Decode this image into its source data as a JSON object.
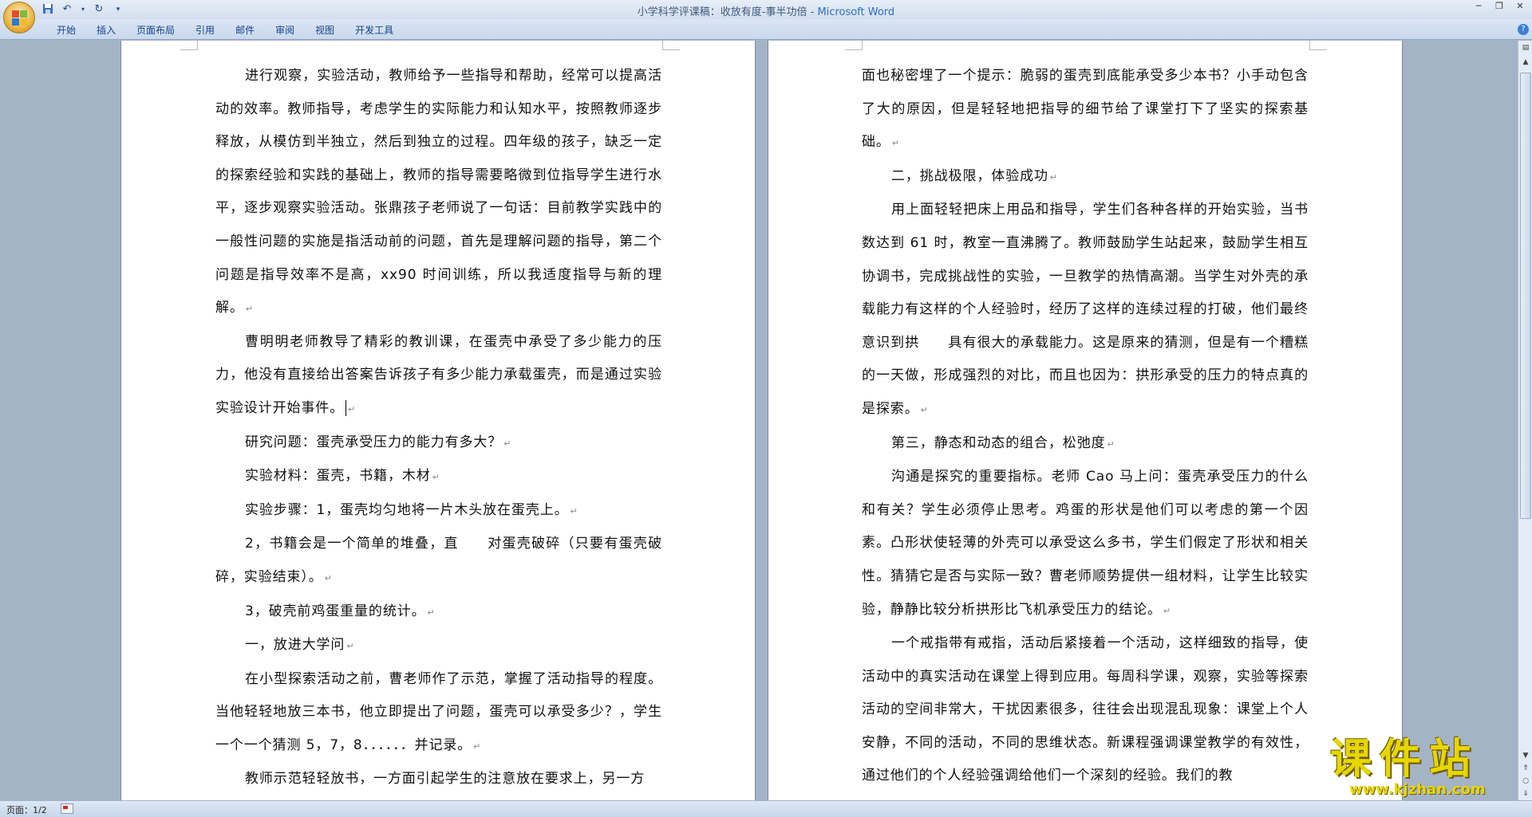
{
  "window": {
    "title_doc": "小学科学评课稿：收放有度-事半功倍",
    "title_sep": " - ",
    "title_app": "Microsoft Word"
  },
  "quick_access": [
    "save",
    "undo",
    "redo",
    "customize"
  ],
  "ribbon": {
    "tabs": [
      "开始",
      "插入",
      "页面布局",
      "引用",
      "邮件",
      "审阅",
      "视图",
      "开发工具"
    ]
  },
  "page1": [
    {
      "text": "进行观察，实验活动，教师给予一些指导和帮助，经常可以提高活动的效率。教师指导，考虑学生的实际能力和认知水平，按照教师逐步释放，从模仿到半独立，然后到独立的过程。四年级的孩子，缺乏一定的探索经验和实践的基础上，教师的指导需要略微到位指导学生进行水平，逐步观察实验活动。张鼎孩子老师说了一句话：目前教学实践中的一般性问题的实施是指活动前的问题，首先是理解问题的指导，第二个问题是指导效率不是高，xx90 时间训练，所以我适度指导与新的理解。"
    },
    {
      "text": "曹明明老师教导了精彩的教训课，在蛋壳中承受了多少能力的压力，他没有直接给出答案告诉孩子有多少能力承载蛋壳，而是通过实验实验设计开始事件。"
    },
    {
      "text": "研究问题：蛋壳承受压力的能力有多大？"
    },
    {
      "text": "实验材料：蛋壳，书籍，木材"
    },
    {
      "text": "实验步骤：1，蛋壳均匀地将一片木头放在蛋壳上。"
    },
    {
      "text": "2，书籍会是一个简单的堆叠，直　　对蛋壳破碎（只要有蛋壳破碎，实验结束）。"
    },
    {
      "text": "3，破壳前鸡蛋重量的统计。"
    },
    {
      "text": "一，放进大学问"
    },
    {
      "text": "在小型探索活动之前，曹老师作了示范，掌握了活动指导的程度。当他轻轻地放三本书，他立即提出了问题，蛋壳可以承受多少？，学生一个一个猜测 5，7，8．．．．．．并记录。"
    },
    {
      "text": "教师示范轻轻放书，一方面引起学生的注意放在要求上，另一方"
    }
  ],
  "page2": [
    {
      "text": "面也秘密埋了一个提示：脆弱的蛋壳到底能承受多少本书？小手动包含了大的原因，但是轻轻地把指导的细节给了课堂打下了坚实的探索基础。"
    },
    {
      "text": "二，挑战极限，体验成功"
    },
    {
      "text": "用上面轻轻把床上用品和指导，学生们各种各样的开始实验，当书数达到 61 时，教室一直沸腾了。教师鼓励学生站起来，鼓励学生相互协调书，完成挑战性的实验，一旦教学的热情高潮。当学生对外壳的承载能力有这样的个人经验时，经历了这样的连续过程的打破，他们最终意识到拱　　具有很大的承载能力。这是原来的猜测，但是有一个糟糕的一天做，形成强烈的对比，而且也因为：拱形承受的压力的特点真的是探索。"
    },
    {
      "text": "第三，静态和动态的组合，松弛度"
    },
    {
      "text": "沟通是探究的重要指标。老师 Cao 马上问：蛋壳承受压力的什么和有关？学生必须停止思考。鸡蛋的形状是他们可以考虑的第一个因素。凸形状使轻薄的外壳可以承受这么多书，学生们假定了形状和相关性。猜猜它是否与实际一致？曹老师顺势提供一组材料，让学生比较实验，静静比较分析拱形比飞机承受压力的结论。"
    },
    {
      "text": "一个戒指带有戒指，活动后紧接着一个活动，这样细致的指导，使活动中的真实活动在课堂上得到应用。每周科学课，观察，实验等探索活动的空间非常大，干扰因素很多，往往会出现混乱现象：课堂上个人安静，不同的活动，不同的思维状态。新课程强调课堂教学的有效性，通过他们的个人经验强调给他们一个深刻的经验。我们的教"
    }
  ],
  "status": {
    "page_label": "页面：1/2"
  },
  "watermark": {
    "main": "课件站",
    "url": "www.kjzhan.com"
  },
  "colors": {
    "app_blue": "#2b6fc2",
    "tab_text": "#15428b",
    "watermark_yellow": "#e6d600",
    "doc_background": "#a4b3c6"
  }
}
